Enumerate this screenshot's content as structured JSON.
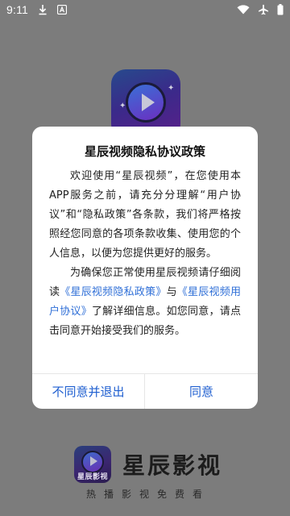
{
  "status_bar": {
    "time": "9:11",
    "left_icons": [
      "download-icon",
      "notification-a-icon"
    ],
    "right_icons": [
      "wifi-icon",
      "airplane-mode-icon",
      "battery-icon"
    ]
  },
  "app": {
    "name": "星辰影视",
    "slogan": "热播影视免费看",
    "logo_text": "星辰影视"
  },
  "dialog": {
    "title": "星辰视频隐私协议政策",
    "para1": "欢迎使用“星辰视频”，在您使用本APP服务之前，请充分分理解“用户协议”和“隐私政策”各条款，我们将严格按照经您同意的各项条款收集、使用您的个人信息，以便为您提供更好的服务。",
    "para2_pre": "为确保您正常使用星辰视频请仔细阅读",
    "privacy_link": "《星辰视频隐私政策》",
    "para2_mid": "与",
    "user_link": "《星辰视频用户协议》",
    "para2_post": "了解详细信息。如您同意，请点击同意开始接受我们的服务。",
    "decline_label": "不同意并退出",
    "agree_label": "同意"
  },
  "colors": {
    "accent": "#1f5fd0",
    "link": "#2f6fd7",
    "overlay": "#7c7c7c"
  }
}
